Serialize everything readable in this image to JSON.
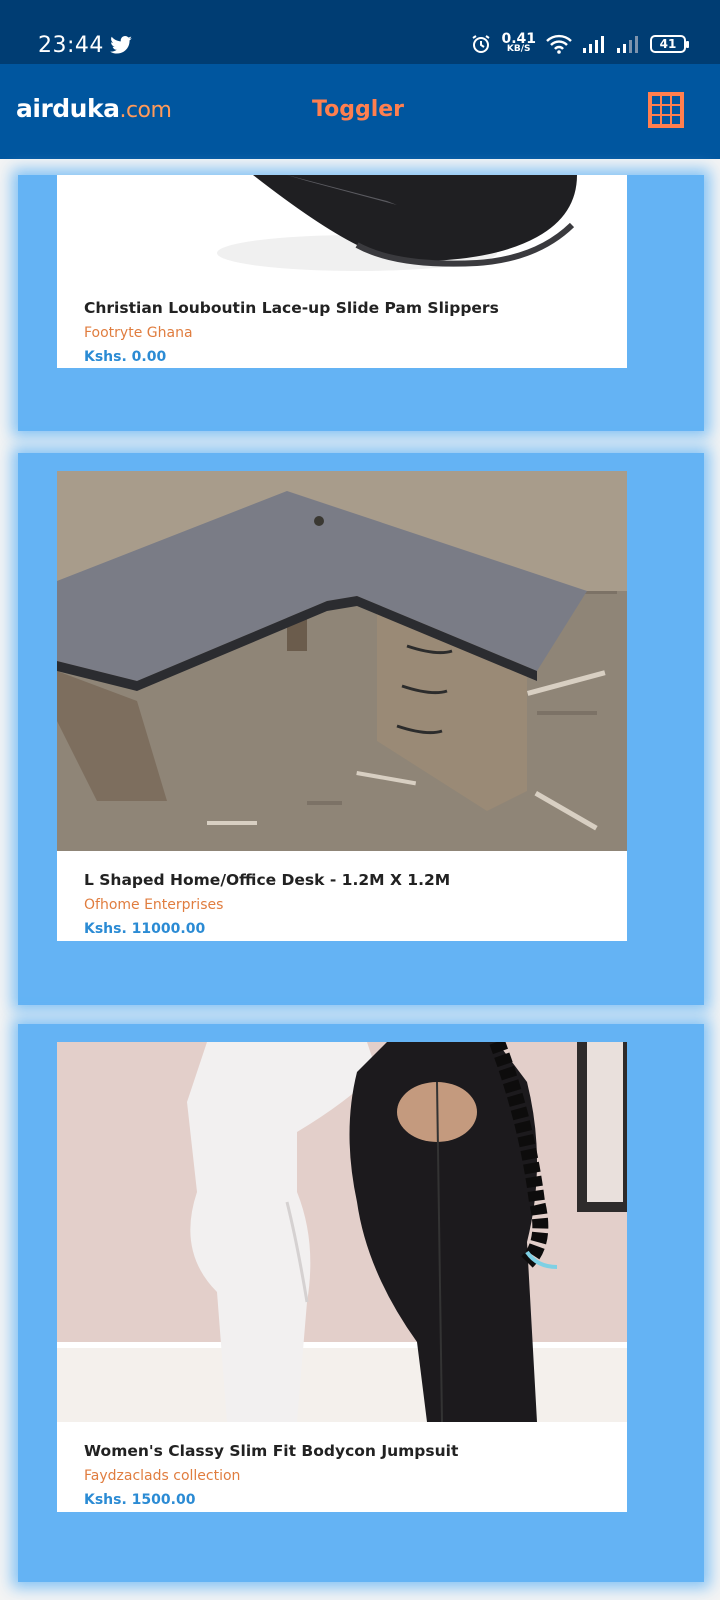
{
  "status": {
    "time": "23:44",
    "net_value": "0.41",
    "net_unit": "KB/S",
    "battery": "41"
  },
  "app": {
    "logo_main": "airduka",
    "logo_domain": ".com",
    "toggler": "Toggler"
  },
  "products": [
    {
      "title": "Christian Louboutin Lace-up Slide Pam Slippers",
      "seller": "Footryte Ghana",
      "price": "Kshs. 0.00"
    },
    {
      "title": "L Shaped Home/Office Desk - 1.2M X 1.2M",
      "seller": "Ofhome Enterprises",
      "price": "Kshs. 11000.00"
    },
    {
      "title": "Women's Classy Slim Fit Bodycon Jumpsuit",
      "seller": "Faydzaclads collection",
      "price": "Kshs. 1500.00"
    }
  ]
}
